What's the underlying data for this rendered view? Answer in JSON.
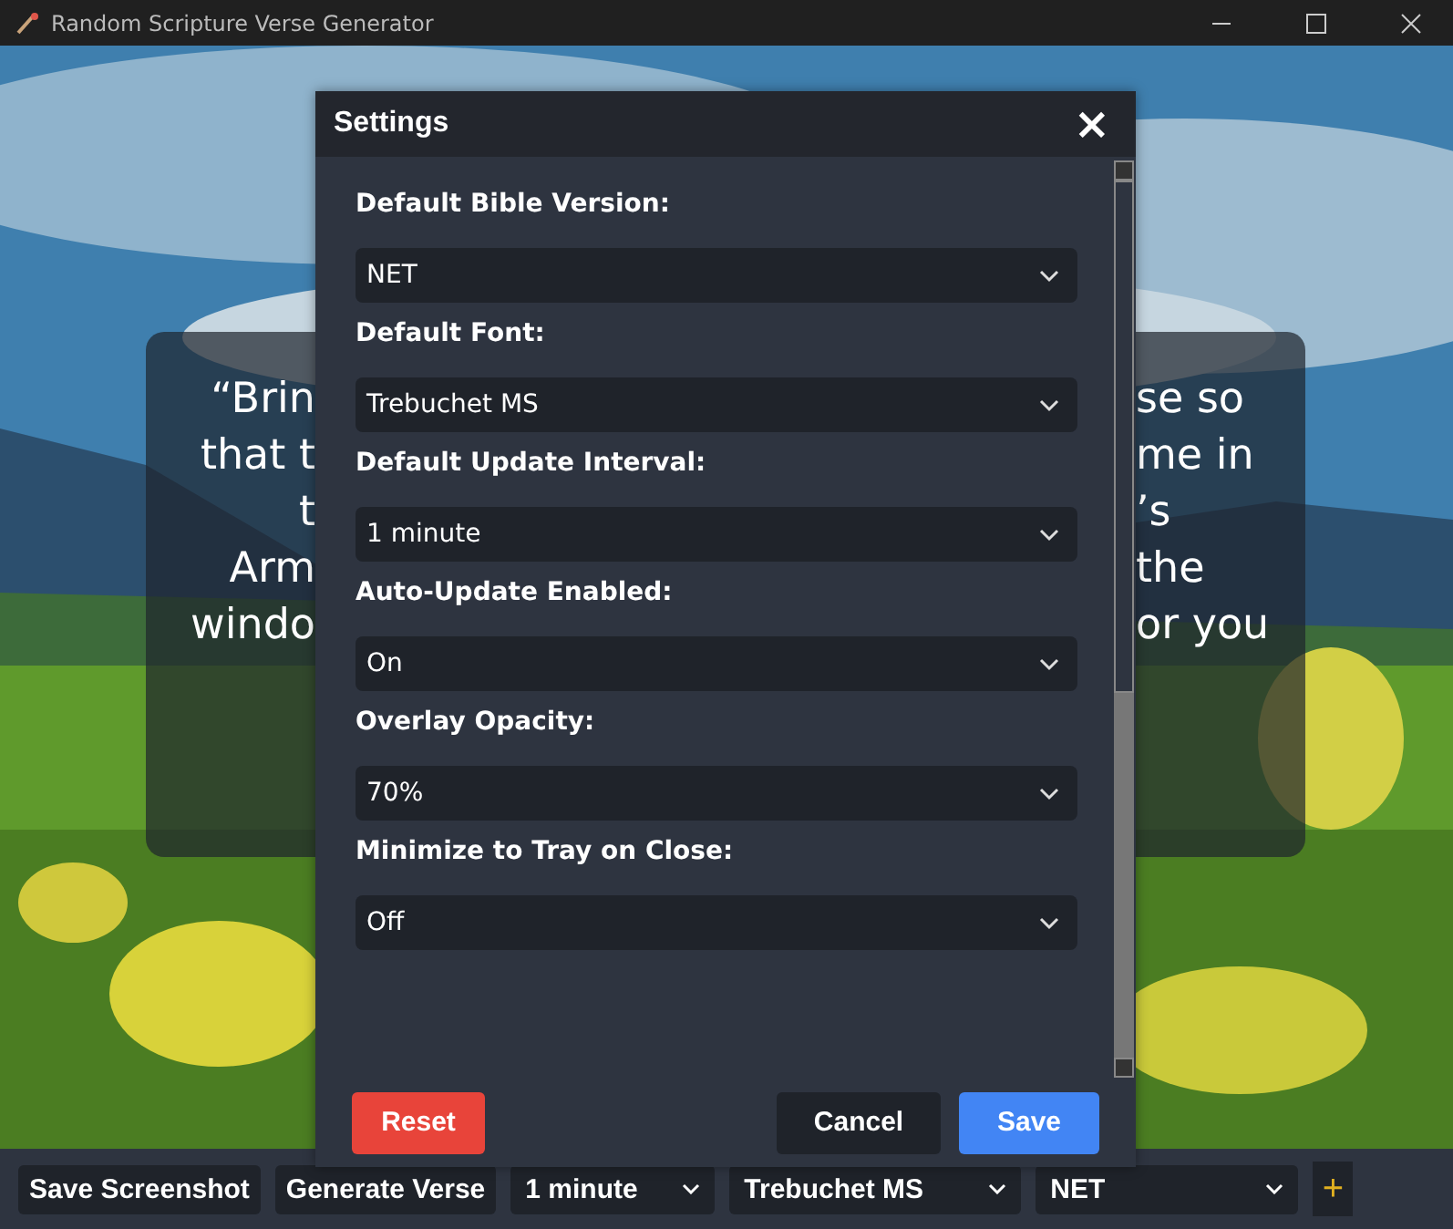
{
  "window": {
    "title": "Random Scripture Verse Generator"
  },
  "verse": {
    "left_lines": [
      "“Brin",
      "that t",
      "t",
      "Arm",
      "windo"
    ],
    "right_lines": [
      "se so",
      "me in",
      "’s",
      "the",
      "or you"
    ]
  },
  "settings": {
    "title": "Settings",
    "close": "×",
    "fields": [
      {
        "label": "Default Bible Version:",
        "value": "NET"
      },
      {
        "label": "Default Font:",
        "value": "Trebuchet MS"
      },
      {
        "label": "Default Update Interval:",
        "value": "1 minute"
      },
      {
        "label": "Auto-Update Enabled:",
        "value": "On"
      },
      {
        "label": "Overlay Opacity:",
        "value": "70%"
      },
      {
        "label": "Minimize to Tray on Close:",
        "value": "Off"
      }
    ],
    "buttons": [
      {
        "label": "Reset",
        "kind": "danger"
      },
      {
        "label": "Cancel",
        "kind": "plain"
      },
      {
        "label": "Save",
        "kind": "primary"
      }
    ]
  },
  "toolbar": {
    "buttons": [
      "Save Screenshot",
      "Generate Verse"
    ],
    "selects": [
      {
        "value": "1 minute"
      },
      {
        "value": "Trebuchet MS"
      },
      {
        "value": "NET"
      }
    ],
    "add": "+"
  }
}
